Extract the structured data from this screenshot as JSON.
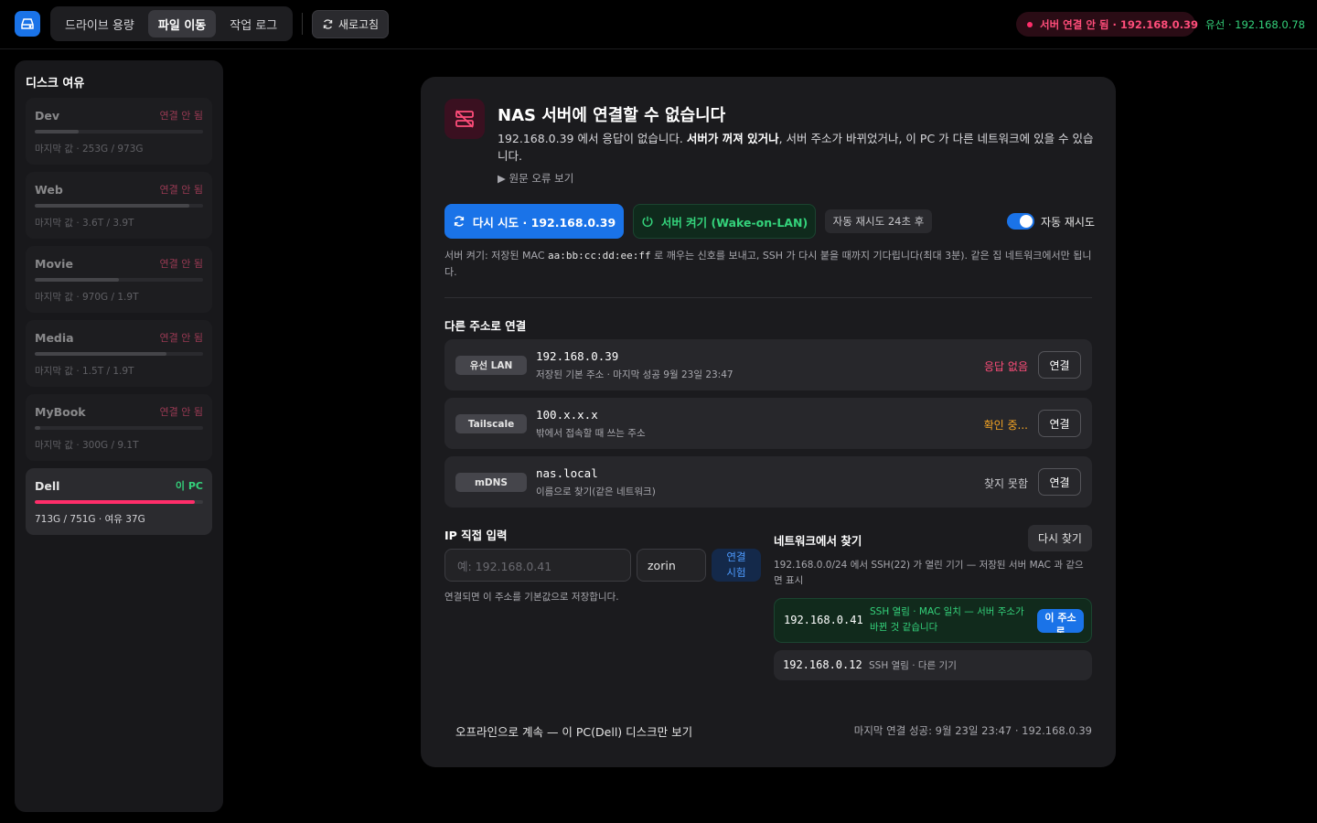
{
  "topbar": {
    "app_icon": "drive-icon",
    "tabs": [
      {
        "label": "드라이브 용량",
        "active": false
      },
      {
        "label": "파일 이동",
        "active": true
      },
      {
        "label": "작업 로그",
        "active": false
      }
    ],
    "refresh_label": "새로고침",
    "status_text": "서버 연결 안 됨 · 192.168.0.39",
    "wired_text": "유선 · 192.168.0.78",
    "colors": {
      "accent": "#1a73e8",
      "error": "#ff2d6a",
      "success": "#34d27b"
    }
  },
  "sidebar": {
    "title": "디스크 여유",
    "disks": [
      {
        "name": "Dev",
        "status": "연결 안 됨",
        "sub": "마지막 값 · 253G / 973G",
        "fill": 0.26,
        "current": false
      },
      {
        "name": "Web",
        "status": "연결 안 됨",
        "sub": "마지막 값 · 3.6T / 3.9T",
        "fill": 0.92,
        "current": false
      },
      {
        "name": "Movie",
        "status": "연결 안 됨",
        "sub": "마지막 값 · 970G / 1.9T",
        "fill": 0.5,
        "current": false
      },
      {
        "name": "Media",
        "status": "연결 안 됨",
        "sub": "마지막 값 · 1.5T / 1.9T",
        "fill": 0.78,
        "current": false
      },
      {
        "name": "MyBook",
        "status": "연결 안 됨",
        "sub": "마지막 값 · 300G / 9.1T",
        "fill": 0.03,
        "current": false
      },
      {
        "name": "Dell",
        "status": "이 PC",
        "sub": "713G / 751G · 여유 37G",
        "fill": 0.95,
        "current": true
      }
    ]
  },
  "card": {
    "icon": "server-off-icon",
    "title": "NAS 서버에 연결할 수 없습니다",
    "desc_prefix": "192.168.0.39 에서 응답이 없습니다. ",
    "desc_bold": "서버가 꺼져 있거나",
    "desc_suffix": ", 서버 주소가 바뀌었거나, 이 PC 가 다른 네트워크에 있을 수 있습니다.",
    "raw_error": "원문 오류 보기",
    "retry_label": "다시 시도 · 192.168.0.39",
    "wol_label": "서버 켜기 (Wake-on-LAN)",
    "auto_retry_pill": "자동 재시도 24초 후",
    "auto_retry_toggle": "자동 재시도",
    "auto_retry_on": true,
    "wol_note_prefix": "서버 켜기: 저장된 MAC ",
    "wol_mac": "aa:bb:cc:dd:ee:ff",
    "wol_note_suffix": " 로 깨우는 신호를 보내고, SSH 가 다시 붙을 때까지 기다립니다(최대 3분). 같은 집 네트워크에서만 됩니다.",
    "alt_title": "다른 주소로 연결",
    "addresses": [
      {
        "tag": "유선 LAN",
        "address": "192.168.0.39",
        "sub": "저장된 기본 주소 · 마지막 성공 9월 23일 23:47",
        "status": "응답 없음",
        "status_color": "#ff4d7a",
        "connect": "연결"
      },
      {
        "tag": "Tailscale",
        "address": "100.x.x.x",
        "sub": "밖에서 접속할 때 쓰는 주소",
        "status": "확인 중...",
        "status_color": "#f5a524",
        "connect": "연결"
      },
      {
        "tag": "mDNS",
        "address": "nas.local",
        "sub": "이름으로 찾기(같은 네트워크)",
        "status": "찾지 못함",
        "status_color": "#c8c8cc",
        "connect": "연결"
      }
    ],
    "ip_title": "IP 직접 입력",
    "ip_placeholder": "예: 192.168.0.41",
    "user_value": "zorin",
    "test_label": "연결 시험",
    "ip_note": "연결되면 이 주소를 기본값으로 저장합니다.",
    "scan_title": "네트워크에서 찾기",
    "rescan_label": "다시 찾기",
    "scan_note": "192.168.0.0/24 에서 SSH(22) 가 열린 기기 — 저장된 서버 MAC 과 같으면 표시",
    "found": [
      {
        "ip": "192.168.0.41",
        "desc": "SSH 열림 · MAC 일치 — 서버 주소가 바뀐 것 같습니다",
        "use_label": "이 주소로",
        "match": true
      },
      {
        "ip": "192.168.0.12",
        "desc": "SSH 열림 · 다른 기기",
        "match": false
      }
    ],
    "offline_link": "오프라인으로 계속 — 이 PC(Dell) 디스크만 보기",
    "last_ok": "마지막 연결 성공: 9월 23일 23:47 · 192.168.0.39"
  }
}
